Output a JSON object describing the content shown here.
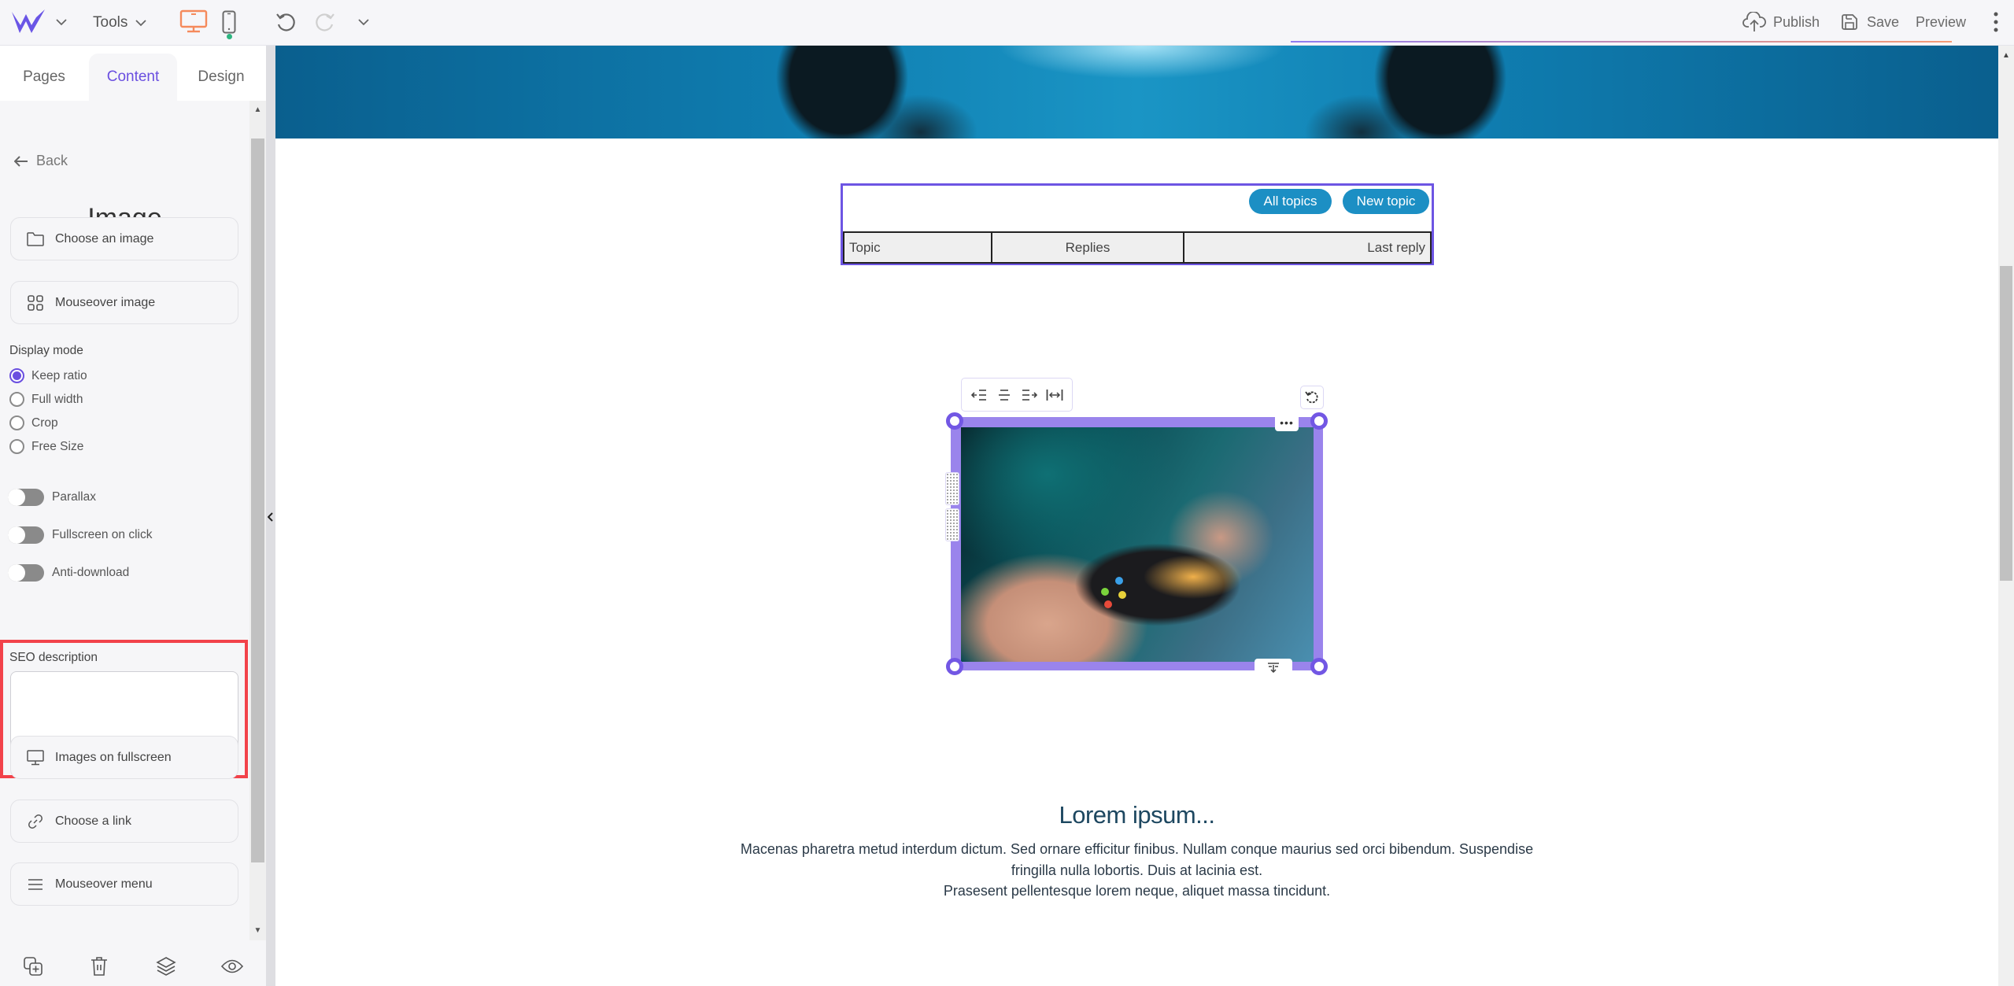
{
  "topbar": {
    "logo": "w-logo-icon",
    "tools_label": "Tools",
    "device_modes": [
      {
        "name": "desktop",
        "icon": "monitor-icon",
        "active": true,
        "color": "#f58a5c"
      },
      {
        "name": "mobile",
        "icon": "smartphone-icon",
        "active": false,
        "indicator_color": "#2db580"
      }
    ],
    "undo_icon": "undo-icon",
    "redo_icon": "redo-icon",
    "publish_label": "Publish",
    "save_label": "Save",
    "preview_label": "Preview"
  },
  "sidebar": {
    "tabs": [
      {
        "label": "Pages",
        "active": false
      },
      {
        "label": "Content",
        "active": true
      },
      {
        "label": "Design",
        "active": false
      }
    ],
    "back_label": "Back",
    "panel_title": "Image",
    "buttons_top": [
      {
        "label": "Choose an image",
        "icon": "folder-icon"
      },
      {
        "label": "Mouseover image",
        "icon": "grid-icon"
      }
    ],
    "display_mode": {
      "label": "Display mode",
      "options": [
        {
          "label": "Keep ratio",
          "checked": true
        },
        {
          "label": "Full width",
          "checked": false
        },
        {
          "label": "Crop",
          "checked": false
        },
        {
          "label": "Free Size",
          "checked": false
        }
      ]
    },
    "toggles": [
      {
        "label": "Parallax",
        "on": false
      },
      {
        "label": "Fullscreen on click",
        "on": false
      },
      {
        "label": "Anti-download",
        "on": false
      }
    ],
    "seo": {
      "label": "SEO description",
      "value": "",
      "placeholder": "",
      "highlight_color": "#f2424a"
    },
    "buttons_bottom": [
      {
        "label": "Images on fullscreen",
        "icon": "monitor-icon"
      },
      {
        "label": "Choose a link",
        "icon": "link-icon"
      },
      {
        "label": "Mouseover menu",
        "icon": "menu-icon"
      }
    ],
    "footer_icons": [
      "duplicate-icon",
      "trash-icon",
      "layers-icon",
      "eye-icon"
    ]
  },
  "canvas": {
    "forum": {
      "buttons": [
        "All topics",
        "New topic"
      ],
      "columns": [
        "Topic",
        "Replies",
        "Last reply"
      ],
      "button_color": "#1c8fc4",
      "selection_color": "#6d55e3"
    },
    "image_toolbar": [
      "align-left-icon",
      "align-center-icon",
      "align-right-icon",
      "stretch-width-icon"
    ],
    "image_selection_color": "#9a84ec",
    "text": {
      "heading": "Lorem ipsum...",
      "paragraph_lines": [
        "Macenas pharetra metud interdum dictum. Sed ornare efficitur finibus. Nullam conque maurius sed orci bibendum. Suspendise",
        "fringilla nulla lobortis. Duis at lacinia est.",
        "Prasesent pellentesque lorem neque, aliquet massa tincidunt."
      ]
    }
  },
  "colors": {
    "accent": "#6a4fe0",
    "topbar_bg": "#f6f6f9",
    "sidebar_bg": "#f6f6f8"
  }
}
